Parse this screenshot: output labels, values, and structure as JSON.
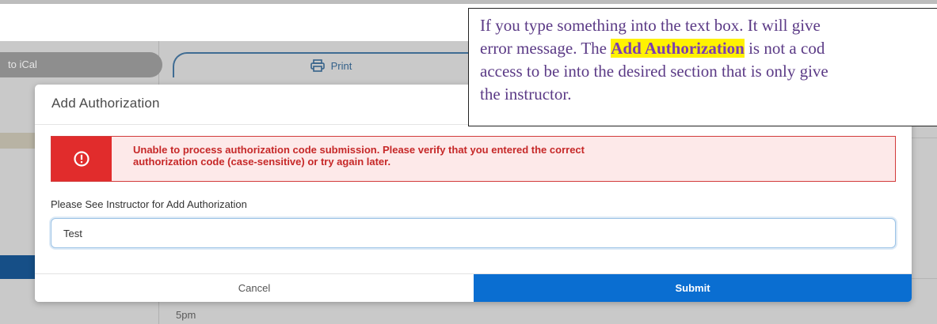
{
  "background": {
    "ical_label": "to iCal",
    "print_label": "Print",
    "time_label": "5pm"
  },
  "modal": {
    "title": "Add Authorization",
    "error_message_line1": "Unable to process authorization code submission. Please verify that you entered the correct",
    "error_message_line2": "authorization code (case-sensitive) or try again later.",
    "field_label": "Please See Instructor for Add Authorization",
    "input_value": "Test",
    "cancel_label": "Cancel",
    "submit_label": "Submit"
  },
  "annotation": {
    "line1": "If you type something into the text box. It will give",
    "line2_before": "error message. The ",
    "line2_highlight": "Add Authorization",
    "line2_after": " is not a cod",
    "line3": "access to be into the desired section that is only give",
    "line4": "the instructor."
  },
  "colors": {
    "submit_blue": "#0a6ed1",
    "error_red": "#e12c2c",
    "error_text": "#c62828",
    "highlight_yellow": "#fff200",
    "annotation_text": "#5b3a86"
  }
}
